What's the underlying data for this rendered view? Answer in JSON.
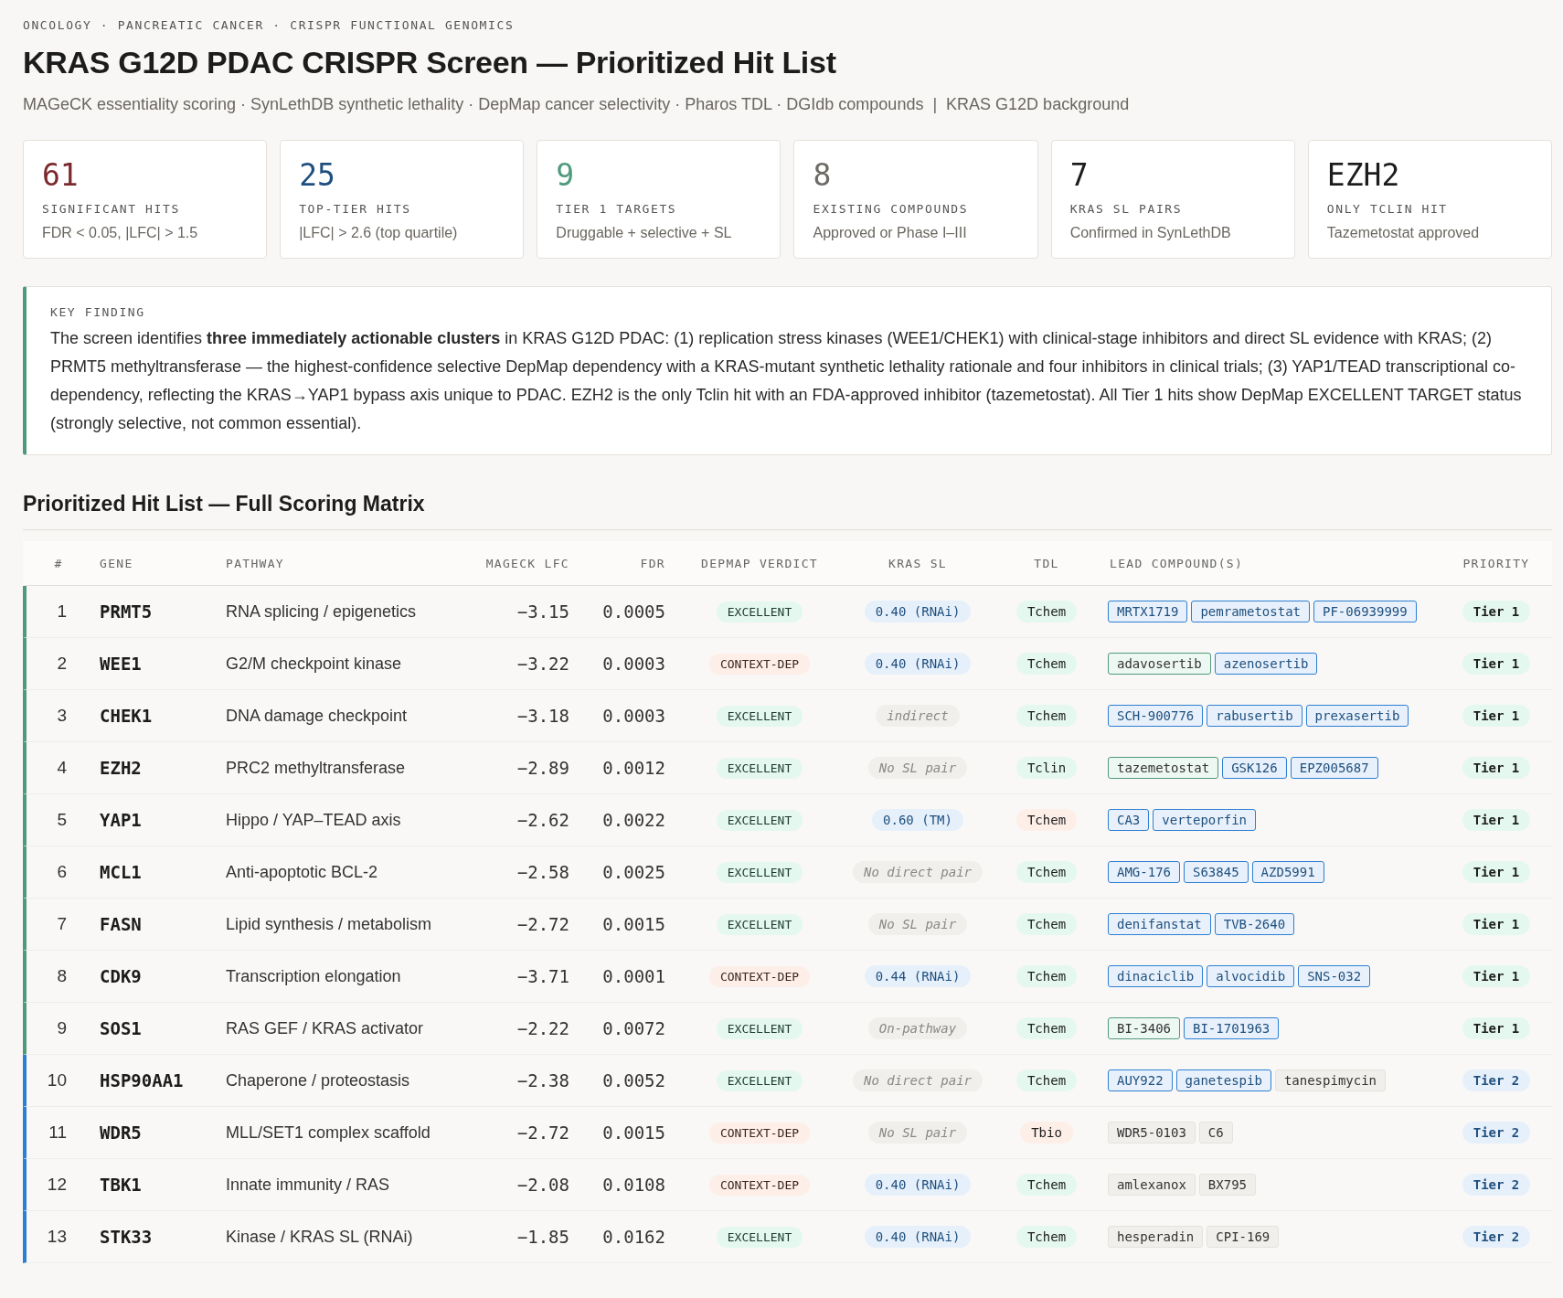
{
  "breadcrumb": "ONCOLOGY · PANCREATIC CANCER · CRISPR FUNCTIONAL GENOMICS",
  "title": "KRAS G12D PDAC CRISPR Screen — Prioritized Hit List",
  "subtitle": "MAGeCK essentiality scoring · SynLethDB synthetic lethality · DepMap cancer selectivity · Pharos TDL · DGIdb compounds  |  KRAS G12D background",
  "stats": [
    {
      "value": "61",
      "label": "SIGNIFICANT HITS",
      "note": "FDR < 0.05, |LFC| > 1.5",
      "color": "#7a2a2e"
    },
    {
      "value": "25",
      "label": "TOP-TIER HITS",
      "note": "|LFC| > 2.6 (top quartile)",
      "color": "#1e4f7e"
    },
    {
      "value": "9",
      "label": "TIER 1 TARGETS",
      "note": "Druggable + selective + SL",
      "color": "#4f9a7c"
    },
    {
      "value": "8",
      "label": "EXISTING COMPOUNDS",
      "note": "Approved or Phase I–III",
      "color": "#6e6a66"
    },
    {
      "value": "7",
      "label": "KRAS SL PAIRS",
      "note": "Confirmed in SynLethDB",
      "color": "#1c1c1c"
    },
    {
      "value": "EZH2",
      "label": "ONLY TCLIN HIT",
      "note": "Tazemetostat approved",
      "color": "#1c1c1c"
    }
  ],
  "key_finding": {
    "label": "KEY FINDING",
    "text": "The screen identifies **three immediately actionable clusters** in KRAS G12D PDAC: (1) replication stress kinases (WEE1/CHEK1) with clinical-stage inhibitors and direct SL evidence with KRAS; (2) PRMT5 methyltransferase — the highest-confidence selective DepMap dependency with a KRAS-mutant synthetic lethality rationale and four inhibitors in clinical trials; (3) YAP1/TEAD transcriptional co-dependency, reflecting the KRAS→YAP1 bypass axis unique to PDAC. EZH2 is the only Tclin hit with an FDA-approved inhibitor (tazemetostat). All Tier 1 hits show DepMap EXCELLENT TARGET status (strongly selective, not common essential)."
  },
  "section_title": "Prioritized Hit List — Full Scoring Matrix",
  "table": {
    "columns": [
      "#",
      "GENE",
      "PATHWAY",
      "MAGECK LFC",
      "FDR",
      "DEPMAP VERDICT",
      "KRAS SL",
      "TDL",
      "LEAD COMPOUND(S)",
      "PRIORITY"
    ],
    "rows": [
      {
        "rank": "1",
        "gene": "PRMT5",
        "pathway": "RNA splicing / epigenetics",
        "lfc": "−3.15",
        "fdr": "0.0005",
        "verdict": {
          "text": "EXCELLENT",
          "kind": "excellent"
        },
        "sl": {
          "text": "0.40 (RNAi)",
          "kind": "score"
        },
        "tdl": {
          "text": "Tchem",
          "kind": "good"
        },
        "compounds": [
          {
            "name": "MRTX1719",
            "kind": "clinical"
          },
          {
            "name": "pemrametostat",
            "kind": "clinical"
          },
          {
            "name": "PF-06939999",
            "kind": "clinical"
          }
        ],
        "priority": {
          "text": "Tier 1",
          "kind": "tier1"
        }
      },
      {
        "rank": "2",
        "gene": "WEE1",
        "pathway": "G2/M checkpoint kinase",
        "lfc": "−3.22",
        "fdr": "0.0003",
        "verdict": {
          "text": "CONTEXT-DEP",
          "kind": "context"
        },
        "sl": {
          "text": "0.40 (RNAi)",
          "kind": "score"
        },
        "tdl": {
          "text": "Tchem",
          "kind": "good"
        },
        "compounds": [
          {
            "name": "adavosertib",
            "kind": "lead"
          },
          {
            "name": "azenosertib",
            "kind": "clinical"
          }
        ],
        "priority": {
          "text": "Tier 1",
          "kind": "tier1"
        }
      },
      {
        "rank": "3",
        "gene": "CHEK1",
        "pathway": "DNA damage checkpoint",
        "lfc": "−3.18",
        "fdr": "0.0003",
        "verdict": {
          "text": "EXCELLENT",
          "kind": "excellent"
        },
        "sl": {
          "text": "indirect",
          "kind": "none"
        },
        "tdl": {
          "text": "Tchem",
          "kind": "good"
        },
        "compounds": [
          {
            "name": "SCH-900776",
            "kind": "clinical"
          },
          {
            "name": "rabusertib",
            "kind": "clinical"
          },
          {
            "name": "prexasertib",
            "kind": "clinical"
          }
        ],
        "priority": {
          "text": "Tier 1",
          "kind": "tier1"
        }
      },
      {
        "rank": "4",
        "gene": "EZH2",
        "pathway": "PRC2 methyltransferase",
        "lfc": "−2.89",
        "fdr": "0.0012",
        "verdict": {
          "text": "EXCELLENT",
          "kind": "excellent"
        },
        "sl": {
          "text": "No SL pair",
          "kind": "none"
        },
        "tdl": {
          "text": "Tclin",
          "kind": "good"
        },
        "compounds": [
          {
            "name": "tazemetostat",
            "kind": "lead"
          },
          {
            "name": "GSK126",
            "kind": "clinical"
          },
          {
            "name": "EPZ005687",
            "kind": "clinical"
          }
        ],
        "priority": {
          "text": "Tier 1",
          "kind": "tier1"
        }
      },
      {
        "rank": "5",
        "gene": "YAP1",
        "pathway": "Hippo / YAP–TEAD axis",
        "lfc": "−2.62",
        "fdr": "0.0022",
        "verdict": {
          "text": "EXCELLENT",
          "kind": "excellent"
        },
        "sl": {
          "text": "0.60 (TM)",
          "kind": "score"
        },
        "tdl": {
          "text": "Tchem",
          "kind": "weak"
        },
        "compounds": [
          {
            "name": "CA3",
            "kind": "clinical"
          },
          {
            "name": "verteporfin",
            "kind": "clinical"
          }
        ],
        "priority": {
          "text": "Tier 1",
          "kind": "tier1"
        }
      },
      {
        "rank": "6",
        "gene": "MCL1",
        "pathway": "Anti-apoptotic BCL-2",
        "lfc": "−2.58",
        "fdr": "0.0025",
        "verdict": {
          "text": "EXCELLENT",
          "kind": "excellent"
        },
        "sl": {
          "text": "No direct pair",
          "kind": "none"
        },
        "tdl": {
          "text": "Tchem",
          "kind": "good"
        },
        "compounds": [
          {
            "name": "AMG-176",
            "kind": "clinical"
          },
          {
            "name": "S63845",
            "kind": "clinical"
          },
          {
            "name": "AZD5991",
            "kind": "clinical"
          }
        ],
        "priority": {
          "text": "Tier 1",
          "kind": "tier1"
        }
      },
      {
        "rank": "7",
        "gene": "FASN",
        "pathway": "Lipid synthesis / metabolism",
        "lfc": "−2.72",
        "fdr": "0.0015",
        "verdict": {
          "text": "EXCELLENT",
          "kind": "excellent"
        },
        "sl": {
          "text": "No SL pair",
          "kind": "none"
        },
        "tdl": {
          "text": "Tchem",
          "kind": "good"
        },
        "compounds": [
          {
            "name": "denifanstat",
            "kind": "clinical"
          },
          {
            "name": "TVB-2640",
            "kind": "clinical"
          }
        ],
        "priority": {
          "text": "Tier 1",
          "kind": "tier1"
        }
      },
      {
        "rank": "8",
        "gene": "CDK9",
        "pathway": "Transcription elongation",
        "lfc": "−3.71",
        "fdr": "0.0001",
        "verdict": {
          "text": "CONTEXT-DEP",
          "kind": "context"
        },
        "sl": {
          "text": "0.44 (RNAi)",
          "kind": "score"
        },
        "tdl": {
          "text": "Tchem",
          "kind": "good"
        },
        "compounds": [
          {
            "name": "dinaciclib",
            "kind": "clinical"
          },
          {
            "name": "alvocidib",
            "kind": "clinical"
          },
          {
            "name": "SNS-032",
            "kind": "clinical"
          }
        ],
        "priority": {
          "text": "Tier 1",
          "kind": "tier1"
        }
      },
      {
        "rank": "9",
        "gene": "SOS1",
        "pathway": "RAS GEF / KRAS activator",
        "lfc": "−2.22",
        "fdr": "0.0072",
        "verdict": {
          "text": "EXCELLENT",
          "kind": "excellent"
        },
        "sl": {
          "text": "On-pathway",
          "kind": "none"
        },
        "tdl": {
          "text": "Tchem",
          "kind": "good"
        },
        "compounds": [
          {
            "name": "BI-3406",
            "kind": "lead"
          },
          {
            "name": "BI-1701963",
            "kind": "clinical"
          }
        ],
        "priority": {
          "text": "Tier 1",
          "kind": "tier1"
        }
      },
      {
        "rank": "10",
        "gene": "HSP90AA1",
        "pathway": "Chaperone / proteostasis",
        "lfc": "−2.38",
        "fdr": "0.0052",
        "verdict": {
          "text": "EXCELLENT",
          "kind": "excellent"
        },
        "sl": {
          "text": "No direct pair",
          "kind": "none"
        },
        "tdl": {
          "text": "Tchem",
          "kind": "good"
        },
        "compounds": [
          {
            "name": "AUY922",
            "kind": "clinical"
          },
          {
            "name": "ganetespib",
            "kind": "clinical"
          },
          {
            "name": "tanespimycin",
            "kind": "preclinical"
          }
        ],
        "priority": {
          "text": "Tier 2",
          "kind": "tier2"
        }
      },
      {
        "rank": "11",
        "gene": "WDR5",
        "pathway": "MLL/SET1 complex scaffold",
        "lfc": "−2.72",
        "fdr": "0.0015",
        "verdict": {
          "text": "CONTEXT-DEP",
          "kind": "context"
        },
        "sl": {
          "text": "No SL pair",
          "kind": "none"
        },
        "tdl": {
          "text": "Tbio",
          "kind": "weak"
        },
        "compounds": [
          {
            "name": "WDR5-0103",
            "kind": "preclinical"
          },
          {
            "name": "C6",
            "kind": "preclinical"
          }
        ],
        "priority": {
          "text": "Tier 2",
          "kind": "tier2"
        }
      },
      {
        "rank": "12",
        "gene": "TBK1",
        "pathway": "Innate immunity / RAS",
        "lfc": "−2.08",
        "fdr": "0.0108",
        "verdict": {
          "text": "CONTEXT-DEP",
          "kind": "context"
        },
        "sl": {
          "text": "0.40 (RNAi)",
          "kind": "score"
        },
        "tdl": {
          "text": "Tchem",
          "kind": "good"
        },
        "compounds": [
          {
            "name": "amlexanox",
            "kind": "preclinical"
          },
          {
            "name": "BX795",
            "kind": "preclinical"
          }
        ],
        "priority": {
          "text": "Tier 2",
          "kind": "tier2"
        }
      },
      {
        "rank": "13",
        "gene": "STK33",
        "pathway": "Kinase / KRAS SL (RNAi)",
        "lfc": "−1.85",
        "fdr": "0.0162",
        "verdict": {
          "text": "EXCELLENT",
          "kind": "excellent"
        },
        "sl": {
          "text": "0.40 (RNAi)",
          "kind": "score"
        },
        "tdl": {
          "text": "Tchem",
          "kind": "good"
        },
        "compounds": [
          {
            "name": "hesperadin",
            "kind": "preclinical"
          },
          {
            "name": "CPI-169",
            "kind": "preclinical"
          }
        ],
        "priority": {
          "text": "Tier 2",
          "kind": "tier2"
        }
      }
    ]
  }
}
